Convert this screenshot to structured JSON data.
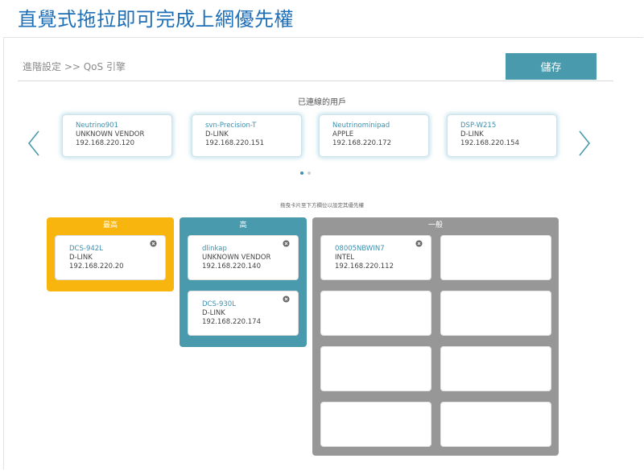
{
  "page_title": "直覺式拖拉即可完成上網優先權",
  "breadcrumb": "進階設定 >> QoS 引擎",
  "save_label": "儲存",
  "connected_title": "已連線的用戶",
  "drag_hint": "拖曳卡片至下方欄位以設定其優先權",
  "carousel": [
    {
      "name": "Neutrino901",
      "vendor": "UNKNOWN VENDOR",
      "ip": "192.168.220.120"
    },
    {
      "name": "svn-Precision-T",
      "vendor": "D-LINK",
      "ip": "192.168.220.151"
    },
    {
      "name": "Neutrinominipad",
      "vendor": "APPLE",
      "ip": "192.168.220.172"
    },
    {
      "name": "DSP-W215",
      "vendor": "D-LINK",
      "ip": "192.168.220.154"
    }
  ],
  "pager": {
    "pages": 2,
    "current": 1
  },
  "priority": {
    "highest": {
      "label": "最高",
      "devices": [
        {
          "name": "DCS-942L",
          "vendor": "D-LINK",
          "ip": "192.168.220.20"
        }
      ]
    },
    "high": {
      "label": "高",
      "devices": [
        {
          "name": "dlinkap",
          "vendor": "UNKNOWN VENDOR",
          "ip": "192.168.220.140"
        },
        {
          "name": "DCS-930L",
          "vendor": "D-LINK",
          "ip": "192.168.220.174"
        }
      ]
    },
    "normal": {
      "label": "一般",
      "devices": [
        {
          "name": "08005NBWIN7",
          "vendor": "INTEL",
          "ip": "192.168.220.112"
        }
      ],
      "empty_slots": 7
    }
  },
  "colors": {
    "title": "#1d6fb8",
    "accent": "#4a9aae",
    "highest": "#f7b50e",
    "high": "#4a9aae",
    "normal": "#979797"
  },
  "icons": {
    "prev": "chevron-left-icon",
    "next": "chevron-right-icon",
    "remove": "remove-circle-icon"
  }
}
